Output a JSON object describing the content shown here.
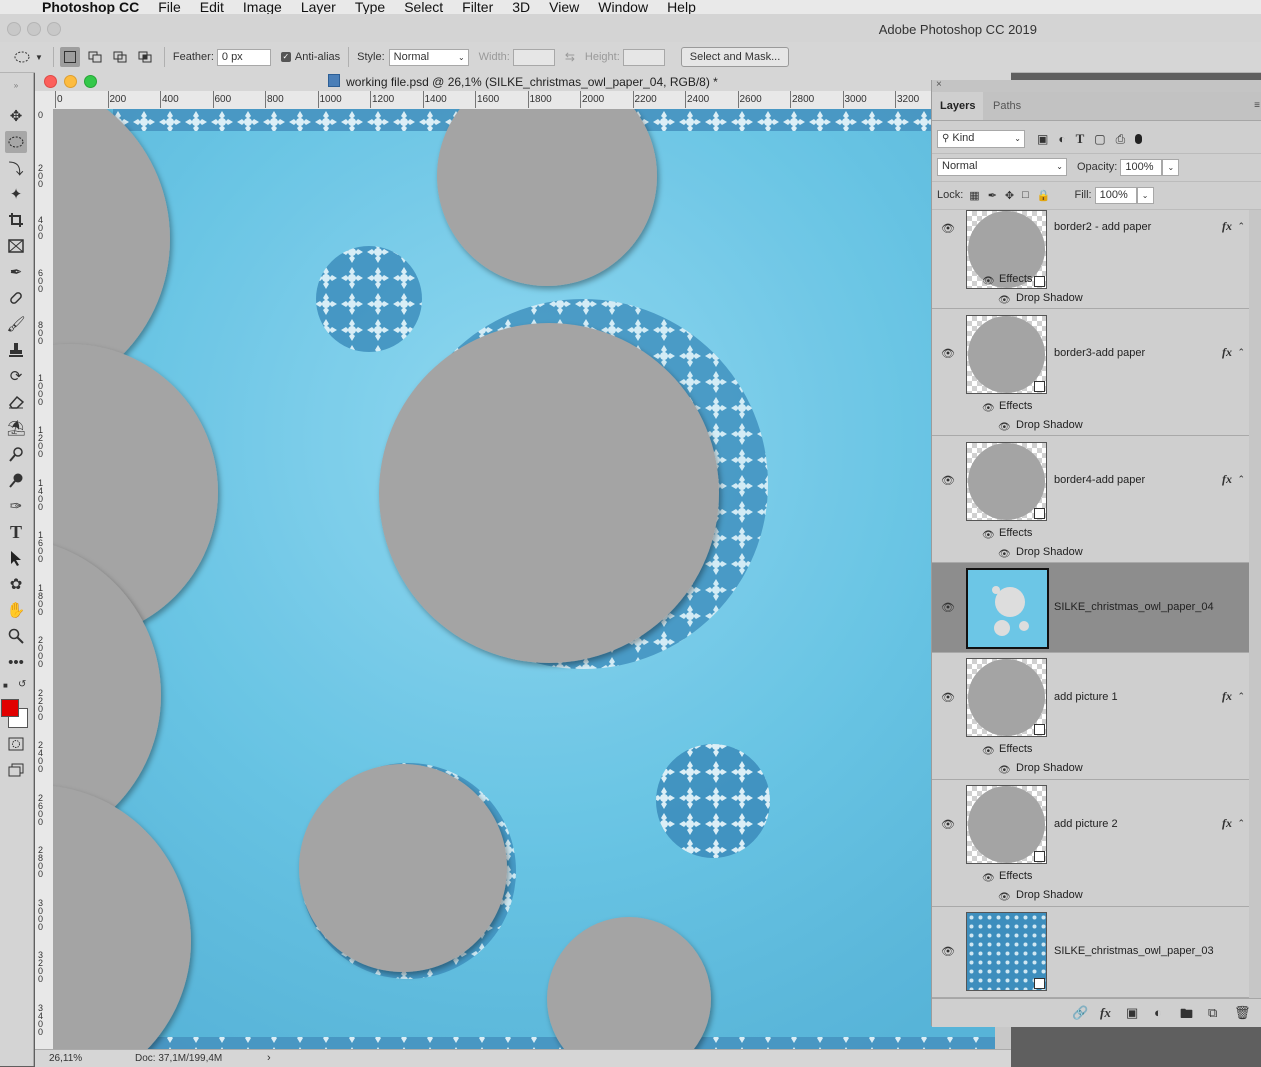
{
  "menubar": {
    "app_name": "Photoshop CC",
    "items": [
      "File",
      "Edit",
      "Image",
      "Layer",
      "Type",
      "Select",
      "Filter",
      "3D",
      "View",
      "Window",
      "Help"
    ]
  },
  "app_title": "Adobe Photoshop CC 2019",
  "options_bar": {
    "feather_label": "Feather:",
    "feather_value": "0 px",
    "antialias_label": "Anti-alias",
    "antialias_checked": true,
    "style_label": "Style:",
    "style_value": "Normal",
    "width_label": "Width:",
    "height_label": "Height:",
    "select_mask_label": "Select and Mask..."
  },
  "document": {
    "title": "working file.psd @ 26,1% (SILKE_christmas_owl_paper_04, RGB/8) *",
    "ruler_h": [
      "0",
      "200",
      "400",
      "600",
      "800",
      "1000",
      "1200",
      "1400",
      "1600",
      "1800",
      "2000",
      "2200",
      "2400",
      "2600",
      "2800",
      "3000",
      "3200"
    ],
    "ruler_v": [
      "0",
      "200",
      "400",
      "600",
      "800",
      "1000",
      "1200",
      "1400",
      "1600",
      "1800",
      "2000",
      "2200",
      "2400",
      "2600",
      "2800",
      "3000",
      "3200",
      "3400"
    ],
    "zoom": "26,11%",
    "doc_size": "Doc: 37,1M/199,4M"
  },
  "colors": {
    "foreground": "#e10000",
    "background": "#ffffff",
    "canvas_paper": "#62bfe0",
    "placeholder_gray": "#a4a4a4",
    "selected_layer": "#8d8d8d"
  },
  "layers_panel": {
    "tabs": [
      "Layers",
      "Paths"
    ],
    "active_tab": "Layers",
    "filter_kind": "Kind",
    "blend_mode": "Normal",
    "opacity_label": "Opacity:",
    "opacity_value": "100%",
    "lock_label": "Lock:",
    "fill_label": "Fill:",
    "fill_value": "100%",
    "effects_label": "Effects",
    "drop_shadow_label": "Drop Shadow",
    "layers": [
      {
        "name": "border2 - add paper",
        "has_fx": true,
        "selected": false
      },
      {
        "name": "border3-add paper",
        "has_fx": true,
        "selected": false
      },
      {
        "name": "border4-add paper",
        "has_fx": true,
        "selected": false
      },
      {
        "name": "SILKE_christmas_owl_paper_04",
        "has_fx": false,
        "selected": true
      },
      {
        "name": "add picture  1",
        "has_fx": true,
        "selected": false
      },
      {
        "name": "add picture 2",
        "has_fx": true,
        "selected": false
      },
      {
        "name": "SILKE_christmas_owl_paper_03",
        "has_fx": false,
        "selected": false
      }
    ]
  },
  "icons": {
    "eye": "eye-icon",
    "fx": "fx-icon",
    "link": "link-icon",
    "mask": "mask-icon",
    "adjustment": "adjustment-icon",
    "folder": "folder-icon",
    "new_layer": "new-layer-icon",
    "trash": "trash-icon"
  }
}
